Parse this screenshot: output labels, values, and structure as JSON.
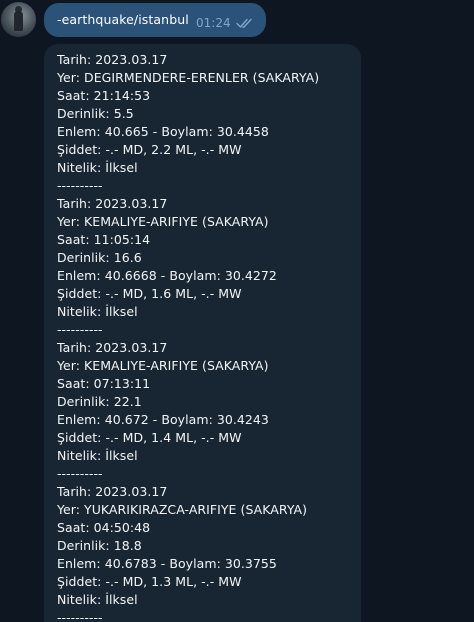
{
  "command": {
    "text": "-earthquake/istanbul",
    "time": "01:24",
    "status_icon": "double-check-icon",
    "colors": {
      "bubble": "#2b5278",
      "meta": "#7da8d3"
    }
  },
  "reply": {
    "colors": {
      "bubble": "#182533",
      "background": "#0e1621"
    },
    "lines": [
      "Tarih: 2023.03.17",
      "Yer: DEGIRMENDERE-ERENLER (SAKARYA)",
      "Saat: 21:14:53",
      "Derinlik: 5.5",
      "Enlem: 40.665 - Boylam: 30.4458",
      "Şiddet: -.- MD,  2.2 ML,  -.- MW",
      "Nitelik: İlksel",
      "----------",
      "Tarih: 2023.03.17",
      "Yer: KEMALIYE-ARIFIYE (SAKARYA)",
      "Saat: 11:05:14",
      "Derinlik: 16.6",
      "Enlem: 40.6668 - Boylam: 30.4272",
      "Şiddet: -.- MD,  1.6 ML,  -.- MW",
      "Nitelik: İlksel",
      "----------",
      "Tarih: 2023.03.17",
      "Yer: KEMALIYE-ARIFIYE (SAKARYA)",
      "Saat: 07:13:11",
      "Derinlik: 22.1",
      "Enlem: 40.672 - Boylam: 30.4243",
      "Şiddet: -.- MD,  1.4 ML,  -.- MW",
      "Nitelik: İlksel",
      "----------",
      "Tarih: 2023.03.17",
      "Yer: YUKARIKIRAZCA-ARIFIYE (SAKARYA)",
      "Saat: 04:50:48",
      "Derinlik: 18.8",
      "Enlem: 40.6783 - Boylam: 30.3755",
      "Şiddet: -.- MD,  1.3 ML,  -.- MW",
      "Nitelik: İlksel",
      "----------"
    ]
  }
}
